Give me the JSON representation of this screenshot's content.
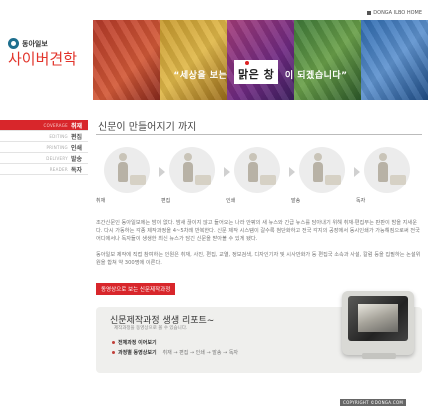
{
  "header": {
    "logo_small": "동아일보",
    "logo_big": "사이버견학",
    "home_link": "DONGA ILBO HOME",
    "slogan_before": "“세상을 보는",
    "slogan_highlight": "맑은 창",
    "slogan_after": "이 되겠습니다”"
  },
  "nav": {
    "items": [
      {
        "en": "COVERAGE",
        "label": "취재",
        "active": true
      },
      {
        "en": "EDITING",
        "label": "편집",
        "active": false
      },
      {
        "en": "PRINTING",
        "label": "인쇄",
        "active": false
      },
      {
        "en": "DELIVERY",
        "label": "발송",
        "active": false
      },
      {
        "en": "READER",
        "label": "독자",
        "active": false
      }
    ]
  },
  "main": {
    "title": "신문이 만들어지기 까지",
    "steps": [
      "취재",
      "편집",
      "인쇄",
      "발송",
      "독자"
    ],
    "paragraph1": "조간신문인 동아일보에는 밤이 없다. 밤새 끊이지 않고 들어오는 나라 안팎의 새 뉴스와 긴급 뉴스를 담아내기 위해 취재·편집부는 판판이 밤을 지새운다. 다시 가동하는 각종 제작과정을 4~5차례 반복한다. 신문 제작 시스템이 갈수록 첨단화하고 전국 각지의 공장에서 동시인쇄가 가능해짐으로써 전국 어디에서나 독자들이 생생한 최신 뉴스가 담긴 신문을 받아볼 수 있게 됐다.",
    "paragraph2": "동아일보 제작에 직접 참여하는 인원은 취재, 사진, 편집, 교열, 정보검색, 디자인기자 및 시사만화가 등 편집국 소속과 사설, 칼럼 등을 집필하는 논설위원을 합쳐 약 300명에 이른다.",
    "video_button": "동영상으로 보는 신문제작과정",
    "video_title": "신문제작과정 생생 리포트~",
    "video_sub": "제작과정을 동영상으로 볼 수 있습니다.",
    "video_full": "전체과정 이어보기",
    "video_each": "과정별 동영상보기",
    "video_seq": "취재 → 편집 → 인쇄 → 발송 → 독자"
  },
  "footer": {
    "copyright": "COPYRIGHT ©DONGA.COM"
  },
  "colors": {
    "accent": "#d8262b",
    "logo": "#e2342b"
  }
}
